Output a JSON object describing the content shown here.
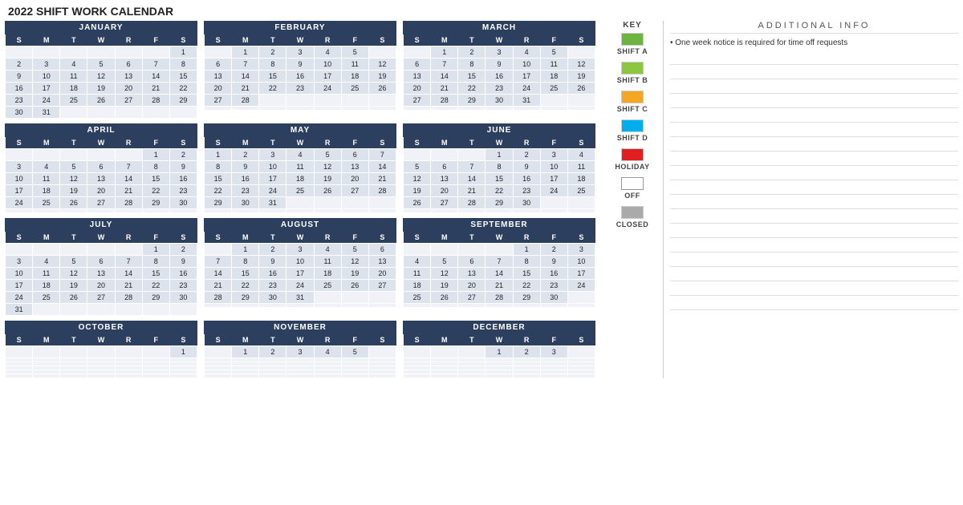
{
  "title": "2022 SHIFT WORK CALENDAR",
  "months": [
    {
      "name": "JANUARY",
      "startDay": 6,
      "days": 31,
      "rows": [
        [
          "",
          "",
          "",
          "",
          "",
          "",
          "1"
        ],
        [
          "2",
          "3",
          "4",
          "5",
          "6",
          "7",
          "8"
        ],
        [
          "9",
          "10",
          "11",
          "12",
          "13",
          "14",
          "15"
        ],
        [
          "16",
          "17",
          "18",
          "19",
          "20",
          "21",
          "22"
        ],
        [
          "23",
          "24",
          "25",
          "26",
          "27",
          "28",
          "29"
        ],
        [
          "30",
          "31",
          "",
          "",
          "",
          "",
          ""
        ]
      ]
    },
    {
      "name": "FEBRUARY",
      "startDay": 2,
      "days": 28,
      "rows": [
        [
          "",
          "1",
          "2",
          "3",
          "4",
          "5",
          ""
        ],
        [
          "6",
          "7",
          "8",
          "9",
          "10",
          "11",
          "12"
        ],
        [
          "13",
          "14",
          "15",
          "16",
          "17",
          "18",
          "19"
        ],
        [
          "20",
          "21",
          "22",
          "23",
          "24",
          "25",
          "26"
        ],
        [
          "27",
          "28",
          "",
          "",
          "",
          "",
          ""
        ],
        [
          "",
          "",
          "",
          "",
          "",
          "",
          ""
        ]
      ]
    },
    {
      "name": "MARCH",
      "startDay": 2,
      "days": 31,
      "rows": [
        [
          "",
          "1",
          "2",
          "3",
          "4",
          "5",
          ""
        ],
        [
          "6",
          "7",
          "8",
          "9",
          "10",
          "11",
          "12"
        ],
        [
          "13",
          "14",
          "15",
          "16",
          "17",
          "18",
          "19"
        ],
        [
          "20",
          "21",
          "22",
          "23",
          "24",
          "25",
          "26"
        ],
        [
          "27",
          "28",
          "29",
          "30",
          "31",
          "",
          ""
        ],
        [
          "",
          "",
          "",
          "",
          "",
          "",
          ""
        ]
      ]
    },
    {
      "name": "APRIL",
      "startDay": 5,
      "days": 30,
      "rows": [
        [
          "",
          "",
          "",
          "",
          "",
          "1",
          "2"
        ],
        [
          "3",
          "4",
          "5",
          "6",
          "7",
          "8",
          "9"
        ],
        [
          "10",
          "11",
          "12",
          "13",
          "14",
          "15",
          "16"
        ],
        [
          "17",
          "18",
          "19",
          "20",
          "21",
          "22",
          "23"
        ],
        [
          "24",
          "25",
          "26",
          "27",
          "28",
          "29",
          "30"
        ],
        [
          "",
          "",
          "",
          "",
          "",
          "",
          ""
        ]
      ]
    },
    {
      "name": "MAY",
      "startDay": 0,
      "days": 31,
      "rows": [
        [
          "1",
          "2",
          "3",
          "4",
          "5",
          "6",
          "7"
        ],
        [
          "8",
          "9",
          "10",
          "11",
          "12",
          "13",
          "14"
        ],
        [
          "15",
          "16",
          "17",
          "18",
          "19",
          "20",
          "21"
        ],
        [
          "22",
          "23",
          "24",
          "25",
          "26",
          "27",
          "28"
        ],
        [
          "29",
          "30",
          "31",
          "",
          "",
          "",
          ""
        ],
        [
          "",
          "",
          "",
          "",
          "",
          "",
          ""
        ]
      ]
    },
    {
      "name": "JUNE",
      "startDay": 3,
      "days": 30,
      "rows": [
        [
          "",
          "",
          "",
          "1",
          "2",
          "3",
          "4"
        ],
        [
          "5",
          "6",
          "7",
          "8",
          "9",
          "10",
          "11"
        ],
        [
          "12",
          "13",
          "14",
          "15",
          "16",
          "17",
          "18"
        ],
        [
          "19",
          "20",
          "21",
          "22",
          "23",
          "24",
          "25"
        ],
        [
          "26",
          "27",
          "28",
          "29",
          "30",
          "",
          ""
        ],
        [
          "",
          "",
          "",
          "",
          "",
          "",
          ""
        ]
      ]
    },
    {
      "name": "JULY",
      "startDay": 5,
      "days": 31,
      "rows": [
        [
          "",
          "",
          "",
          "",
          "",
          "1",
          "2"
        ],
        [
          "3",
          "4",
          "5",
          "6",
          "7",
          "8",
          "9"
        ],
        [
          "10",
          "11",
          "12",
          "13",
          "14",
          "15",
          "16"
        ],
        [
          "17",
          "18",
          "19",
          "20",
          "21",
          "22",
          "23"
        ],
        [
          "24",
          "25",
          "26",
          "27",
          "28",
          "29",
          "30"
        ],
        [
          "31",
          "",
          "",
          "",
          "",
          "",
          ""
        ]
      ]
    },
    {
      "name": "AUGUST",
      "startDay": 1,
      "days": 31,
      "rows": [
        [
          "",
          "1",
          "2",
          "3",
          "4",
          "5",
          "6"
        ],
        [
          "7",
          "8",
          "9",
          "10",
          "11",
          "12",
          "13"
        ],
        [
          "14",
          "15",
          "16",
          "17",
          "18",
          "19",
          "20"
        ],
        [
          "21",
          "22",
          "23",
          "24",
          "25",
          "26",
          "27"
        ],
        [
          "28",
          "29",
          "30",
          "31",
          "",
          "",
          ""
        ],
        [
          "",
          "",
          "",
          "",
          "",
          "",
          ""
        ]
      ]
    },
    {
      "name": "SEPTEMBER",
      "startDay": 4,
      "days": 30,
      "rows": [
        [
          "",
          "",
          "",
          "",
          "1",
          "2",
          "3"
        ],
        [
          "4",
          "5",
          "6",
          "7",
          "8",
          "9",
          "10"
        ],
        [
          "11",
          "12",
          "13",
          "14",
          "15",
          "16",
          "17"
        ],
        [
          "18",
          "19",
          "20",
          "21",
          "22",
          "23",
          "24"
        ],
        [
          "25",
          "26",
          "27",
          "28",
          "29",
          "30",
          ""
        ],
        [
          "",
          "",
          "",
          "",
          "",
          "",
          ""
        ]
      ]
    },
    {
      "name": "OCTOBER",
      "startDay": 6,
      "days": 31,
      "rows": [
        [
          "",
          "",
          "",
          "",
          "",
          "",
          "1"
        ],
        [
          "",
          "",
          "",
          "",
          "",
          "",
          ""
        ],
        [
          "",
          "",
          "",
          "",
          "",
          "",
          ""
        ],
        [
          "",
          "",
          "",
          "",
          "",
          "",
          ""
        ],
        [
          "",
          "",
          "",
          "",
          "",
          "",
          ""
        ],
        [
          "",
          "",
          "",
          "",
          "",
          "",
          ""
        ]
      ]
    },
    {
      "name": "NOVEMBER",
      "startDay": 2,
      "days": 30,
      "rows": [
        [
          "",
          "1",
          "2",
          "3",
          "4",
          "5",
          ""
        ],
        [
          "",
          "",
          "",
          "",
          "",
          "",
          ""
        ],
        [
          "",
          "",
          "",
          "",
          "",
          "",
          ""
        ],
        [
          "",
          "",
          "",
          "",
          "",
          "",
          ""
        ],
        [
          "",
          "",
          "",
          "",
          "",
          "",
          ""
        ],
        [
          "",
          "",
          "",
          "",
          "",
          "",
          ""
        ]
      ]
    },
    {
      "name": "DECEMBER",
      "startDay": 4,
      "days": 31,
      "rows": [
        [
          "",
          "",
          "",
          "1",
          "2",
          "3",
          ""
        ],
        [
          "",
          "",
          "",
          "",
          "",
          "",
          ""
        ],
        [
          "",
          "",
          "",
          "",
          "",
          "",
          ""
        ],
        [
          "",
          "",
          "",
          "",
          "",
          "",
          ""
        ],
        [
          "",
          "",
          "",
          "",
          "",
          "",
          ""
        ],
        [
          "",
          "",
          "",
          "",
          "",
          "",
          ""
        ]
      ]
    }
  ],
  "days_of_week": [
    "S",
    "M",
    "T",
    "W",
    "R",
    "F",
    "S"
  ],
  "key": {
    "title": "KEY",
    "items": [
      {
        "label": "SHIFT A",
        "color": "#6db33f"
      },
      {
        "label": "SHIFT B",
        "color": "#8dc63f"
      },
      {
        "label": "SHIFT C",
        "color": "#f5a623"
      },
      {
        "label": "SHIFT D",
        "color": "#00aeef"
      },
      {
        "label": "HOLIDAY",
        "color": "#e02020"
      },
      {
        "label": "OFF",
        "color": "#ffffff"
      },
      {
        "label": "CLOSED",
        "color": "#aaaaaa"
      }
    ]
  },
  "additional_info": {
    "title": "ADDITIONAL INFO",
    "note": "• One week notice is required for time off requests",
    "lines": 18
  }
}
